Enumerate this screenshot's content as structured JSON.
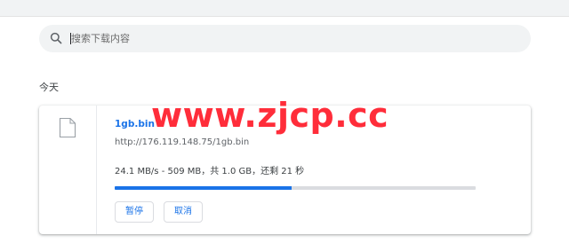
{
  "search": {
    "placeholder": "搜索下载内容",
    "value": ""
  },
  "section": {
    "title": "今天"
  },
  "download": {
    "file_name": "1gb.bin",
    "url": "http://176.119.148.75/1gb.bin",
    "status": "24.1 MB/s - 509 MB，共 1.0 GB，还剩 21 秒",
    "progress_fraction": 0.49,
    "pause_label": "暂停",
    "cancel_label": "取消"
  },
  "overlay": {
    "watermark_text": "www.zjcp.cc"
  },
  "icons": {
    "search": "search-icon",
    "file": "file-icon"
  },
  "colors": {
    "accent": "#1a73e8",
    "watermark": "#ff2d3a",
    "search_bg": "#f1f3f4",
    "progress_track": "#dadce0"
  }
}
